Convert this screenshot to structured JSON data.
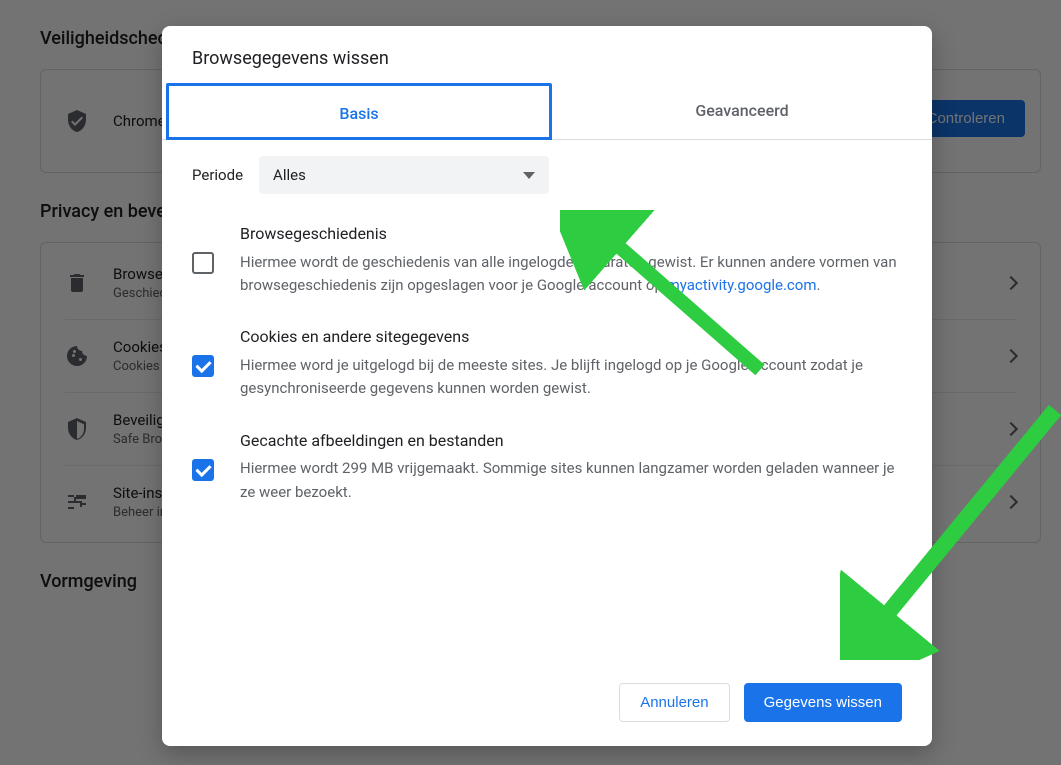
{
  "background": {
    "heading_safety": "Veiligheidscheck",
    "safety_row": {
      "title": "Chrome"
    },
    "check_button": "Controleren",
    "heading_privacy": "Privacy en beveiliging",
    "rows": [
      {
        "title": "Browsegegevens wissen",
        "sub": "Geschiedenis, cookies, cache en meer wissen"
      },
      {
        "title": "Cookies en andere sitegegevens",
        "sub": "Cookies van derden zijn geblokkeerd in de incognitomodus"
      },
      {
        "title": "Beveiliging",
        "sub": "Safe Browsing (bescherming tegen gevaarlijke sites) en andere beveiligingsinstellingen"
      },
      {
        "title": "Site-instellingen",
        "sub": "Beheer instellingen zoals locatie, camera, pop-ups en meer"
      }
    ],
    "heading_appearance": "Vormgeving"
  },
  "dialog": {
    "title": "Browsegegevens wissen",
    "tabs": {
      "basic": "Basis",
      "advanced": "Geavanceerd",
      "active": "basic"
    },
    "periode": {
      "label": "Periode",
      "value": "Alles"
    },
    "options": [
      {
        "checked": false,
        "title": "Browsegeschiedenis",
        "desc_pre": "Hiermee wordt de geschiedenis van alle ingelogde apparaten gewist. Er kunnen andere vormen van browsegeschiedenis zijn opgeslagen voor je Google-account op ",
        "link_text": "myactivity.google.com",
        "desc_post": "."
      },
      {
        "checked": true,
        "title": "Cookies en andere sitegegevens",
        "desc_pre": "Hiermee word je uitgelogd bij de meeste sites. Je blijft ingelogd op je Google-account zodat je gesynchroniseerde gegevens kunnen worden gewist.",
        "link_text": "",
        "desc_post": ""
      },
      {
        "checked": true,
        "title": "Gecachte afbeeldingen en bestanden",
        "desc_pre": "Hiermee wordt 299 MB vrijgemaakt. Sommige sites kunnen langzamer worden geladen wanneer je ze weer bezoekt.",
        "link_text": "",
        "desc_post": ""
      }
    ],
    "buttons": {
      "cancel": "Annuleren",
      "confirm": "Gegevens wissen"
    }
  },
  "colors": {
    "accent": "#1a73e8",
    "arrow": "#2ecc40"
  }
}
